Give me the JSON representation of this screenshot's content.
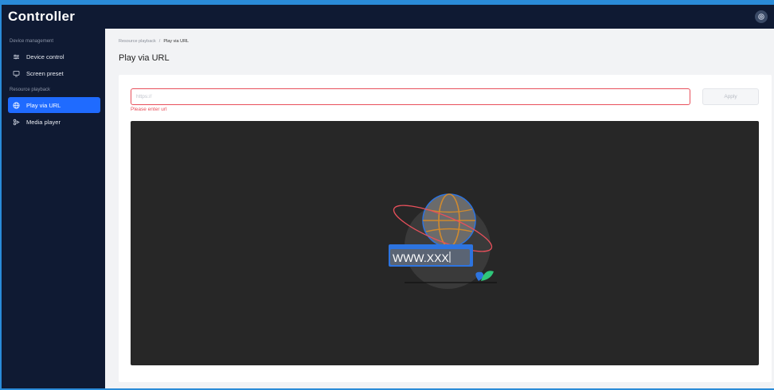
{
  "app": {
    "title": "Controller"
  },
  "sidebar": {
    "groups": [
      {
        "label": "Device management",
        "items": [
          {
            "label": "Device control",
            "icon": "sliders-icon",
            "active": false
          },
          {
            "label": "Screen preset",
            "icon": "monitor-icon",
            "active": false
          }
        ]
      },
      {
        "label": "Resource playback",
        "items": [
          {
            "label": "Play via URL",
            "icon": "globe-icon",
            "active": true
          },
          {
            "label": "Media player",
            "icon": "media-icon",
            "active": false
          }
        ]
      }
    ]
  },
  "breadcrumb": {
    "parent": "Resource playback",
    "separator": "/",
    "current": "Play via URL"
  },
  "page": {
    "title": "Play via URL"
  },
  "form": {
    "url_placeholder": "https://",
    "url_value": "",
    "error": "Please enter url",
    "apply_label": "Apply"
  },
  "player": {
    "illustration_text": "WWW.XXX"
  },
  "colors": {
    "accent": "#1f6bff",
    "sidebar_bg": "#0f1a33",
    "error": "#e8505b",
    "player_bg": "#272727"
  }
}
